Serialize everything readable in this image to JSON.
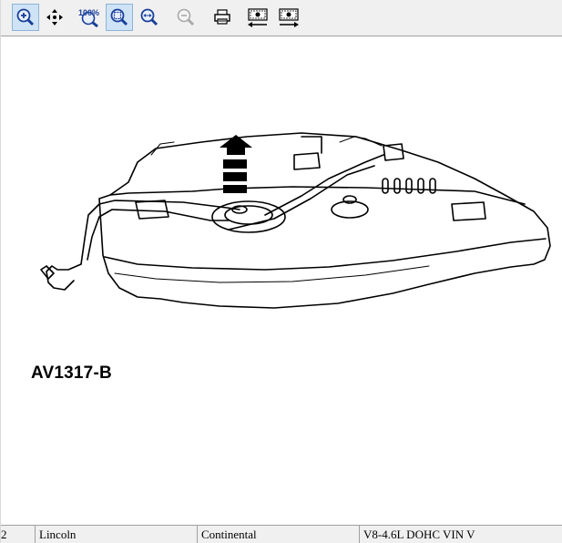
{
  "toolbar": {
    "buttons": [
      {
        "name": "zoom-in-icon",
        "active": true
      },
      {
        "name": "pan-icon",
        "active": false
      },
      {
        "name": "actual-size-icon",
        "label": "100%",
        "active": false
      },
      {
        "name": "zoom-fit-icon",
        "active": true
      },
      {
        "name": "zoom-width-icon",
        "active": false
      },
      {
        "name": "zoom-out-icon",
        "disabled": true
      },
      {
        "name": "print-icon",
        "active": false
      },
      {
        "name": "previous-image-icon",
        "active": false
      },
      {
        "name": "next-image-icon",
        "active": false
      }
    ],
    "actual_size_label": "100%"
  },
  "diagram": {
    "figure_code": "AV1317-B",
    "subject_icon": "fuel-tank-illustration"
  },
  "statusbar": {
    "page": "2",
    "make": "Lincoln",
    "model": "Continental",
    "engine": "V8-4.6L DOHC VIN V"
  },
  "colors": {
    "toolbar_bg": "#f0f0f0",
    "active_button": "#cfe3f6",
    "icon_blue": "#1a3f99"
  }
}
